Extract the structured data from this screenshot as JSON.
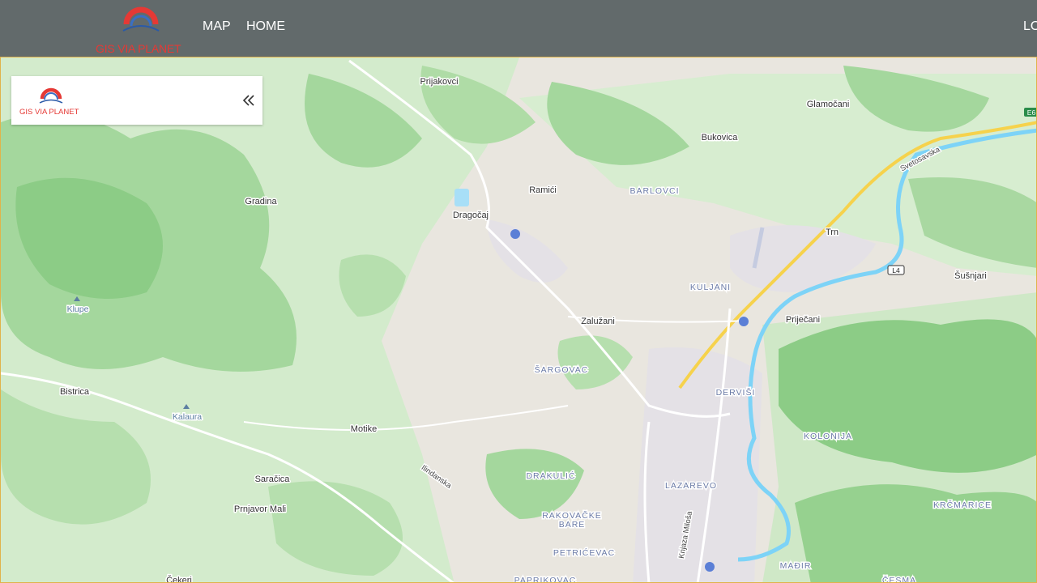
{
  "header": {
    "brand_text": "GIS VIA PLANET",
    "nav": [
      {
        "label": "MAP"
      },
      {
        "label": "HOME"
      }
    ],
    "login_label": "LO"
  },
  "panel": {
    "brand_text": "GIS VIA PLANET"
  },
  "map": {
    "places": [
      "Prijakovci",
      "Glamočani",
      "Bukovica",
      "Gradina",
      "Ramići",
      "Dragočaj",
      "Trn",
      "Šušnjari",
      "Zalužani",
      "Priječani",
      "Bistrica",
      "Motike",
      "Saračica",
      "Prnjavor Mali",
      "Čekeri"
    ],
    "districts": [
      "BARLOVCI",
      "KULJANI",
      "ŠARGOVAC",
      "DERVIŠI",
      "KOLONIJA",
      "DRAKULIĆ",
      "LAZAREVO",
      "RAKOVAČKE",
      "BARE",
      "PETRIĆEVAC",
      "KRČMARICE",
      "MAĐIR",
      "PAPRIKOVAC",
      "ČESMA"
    ],
    "peaks": [
      "Klupe",
      "Kalaura"
    ],
    "roads": [
      "Svetosavska",
      "Ilindanska",
      "Knjaza Miloša"
    ],
    "shields": [
      "L4",
      "E6"
    ],
    "colors": {
      "land": "#e9e6df",
      "forest": "#9fd49a",
      "forest_light": "#c9e6c1",
      "water": "#7dd3f7",
      "motorway": "#f6d24c",
      "urban": "#e4e1e6"
    }
  }
}
